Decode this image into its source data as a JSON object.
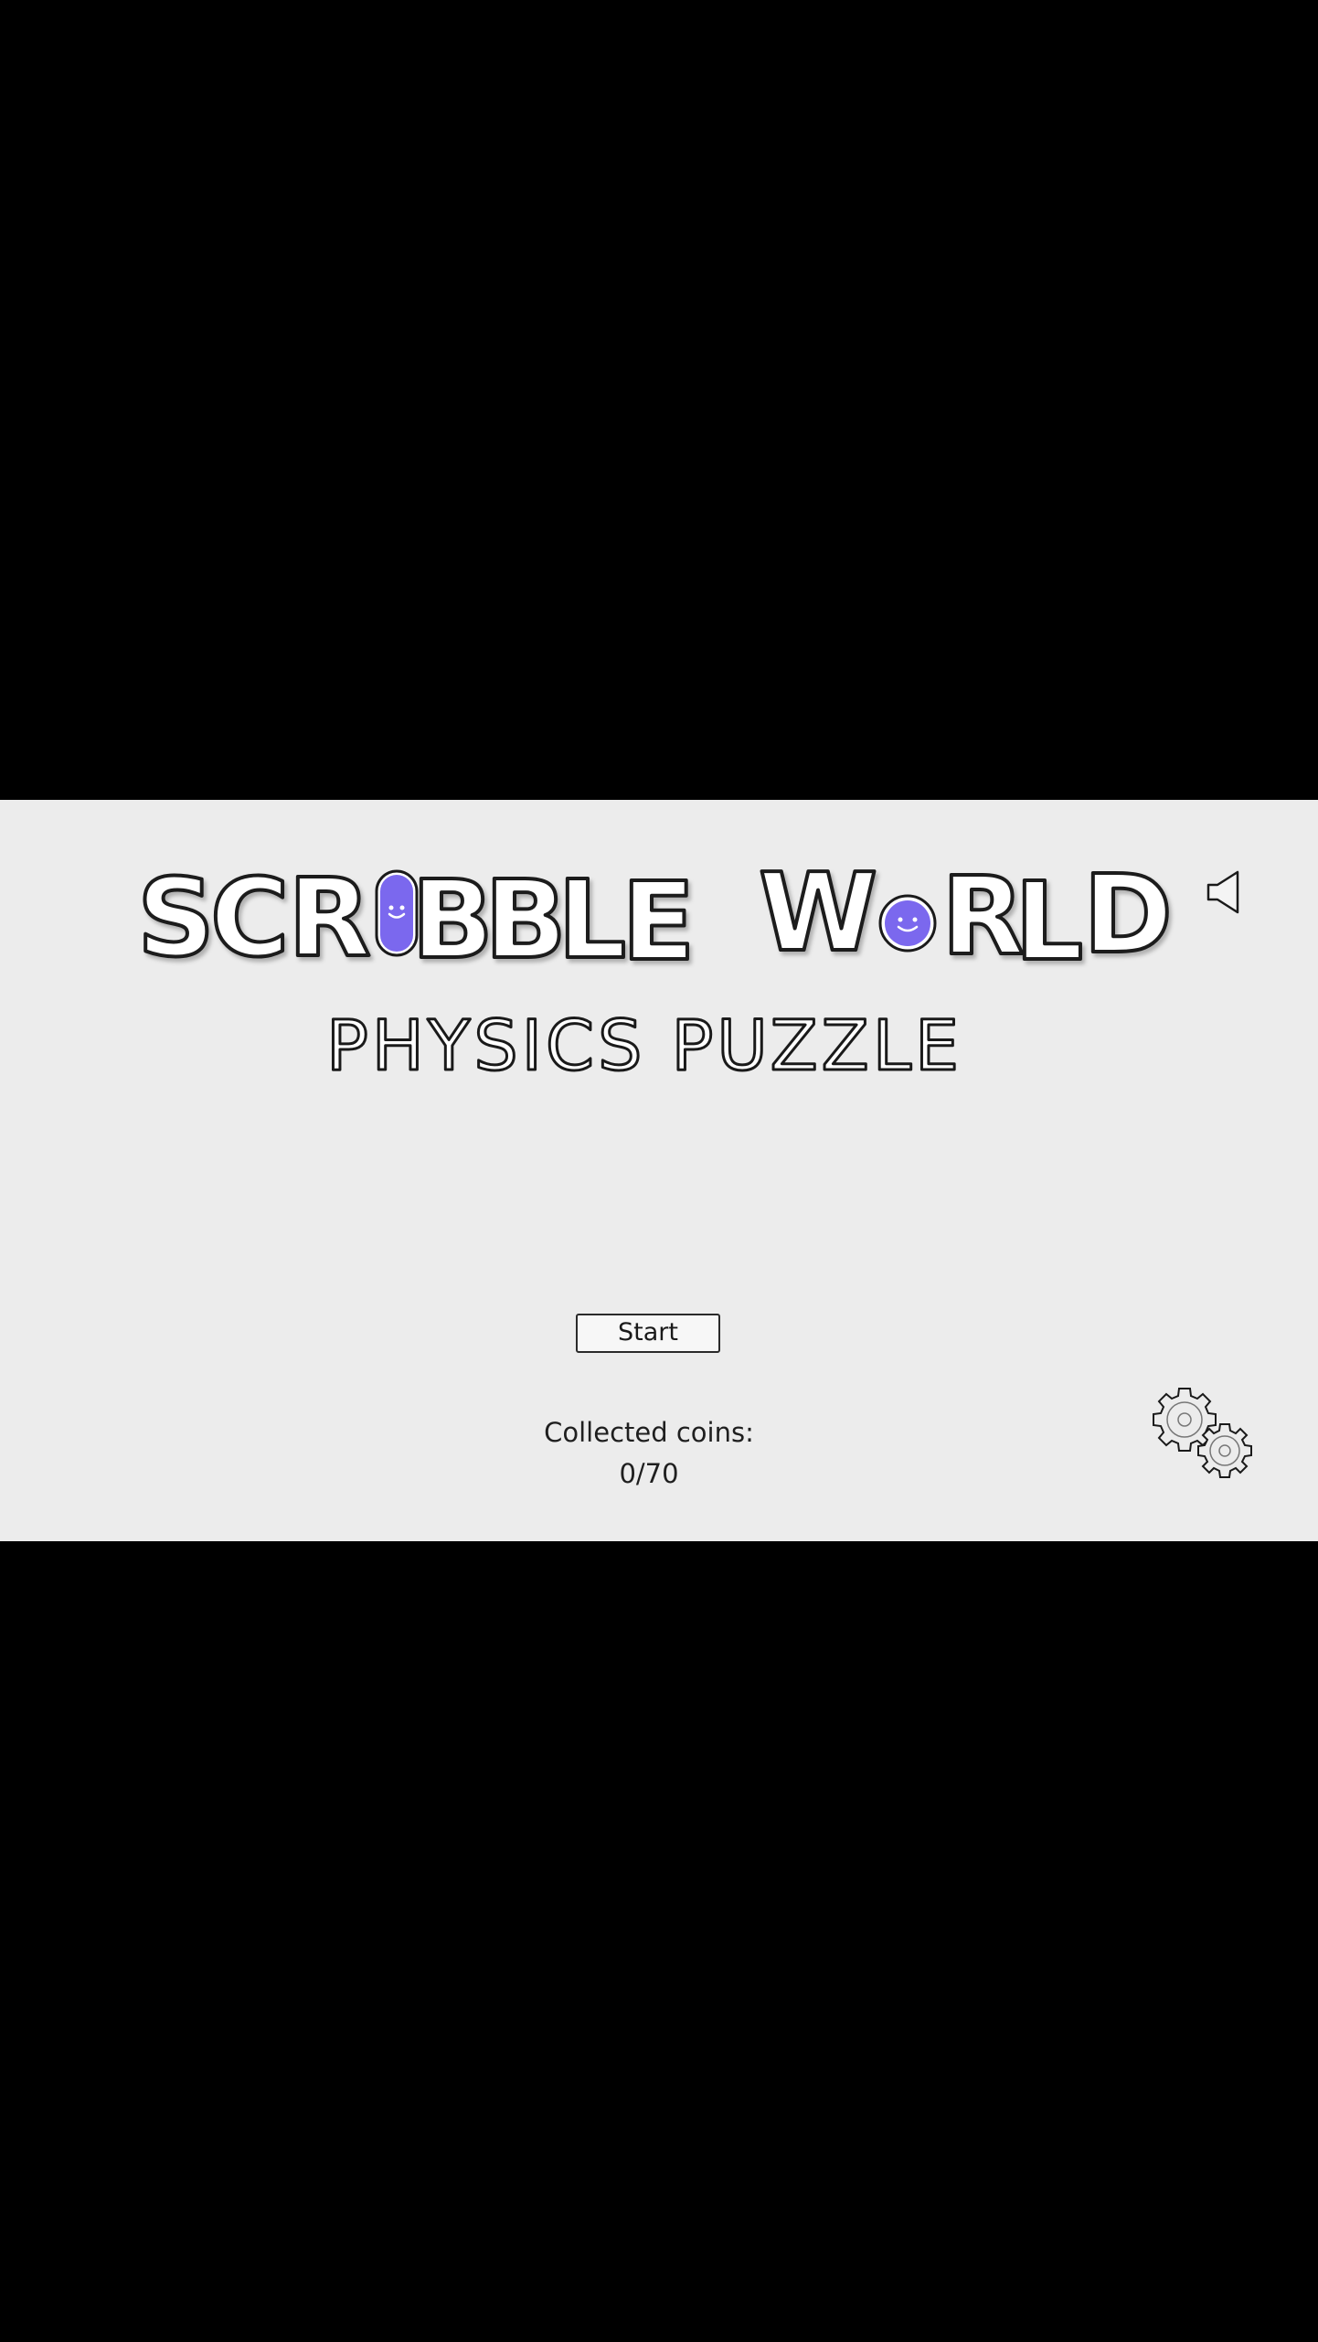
{
  "title": {
    "main": "SCRIBBLE WORLD",
    "sub": "PHYSICS PUZZLE"
  },
  "menu": {
    "start_label": "Start",
    "coins_label": "Collected coins:",
    "coins_value": "0/70"
  },
  "icons": {
    "sound": "speaker-icon",
    "settings": "gears-icon"
  },
  "colors": {
    "screen_bg": "#ececec",
    "letterbox": "#000000",
    "character": "#7b68ee",
    "outline": "#1a1a1a"
  }
}
